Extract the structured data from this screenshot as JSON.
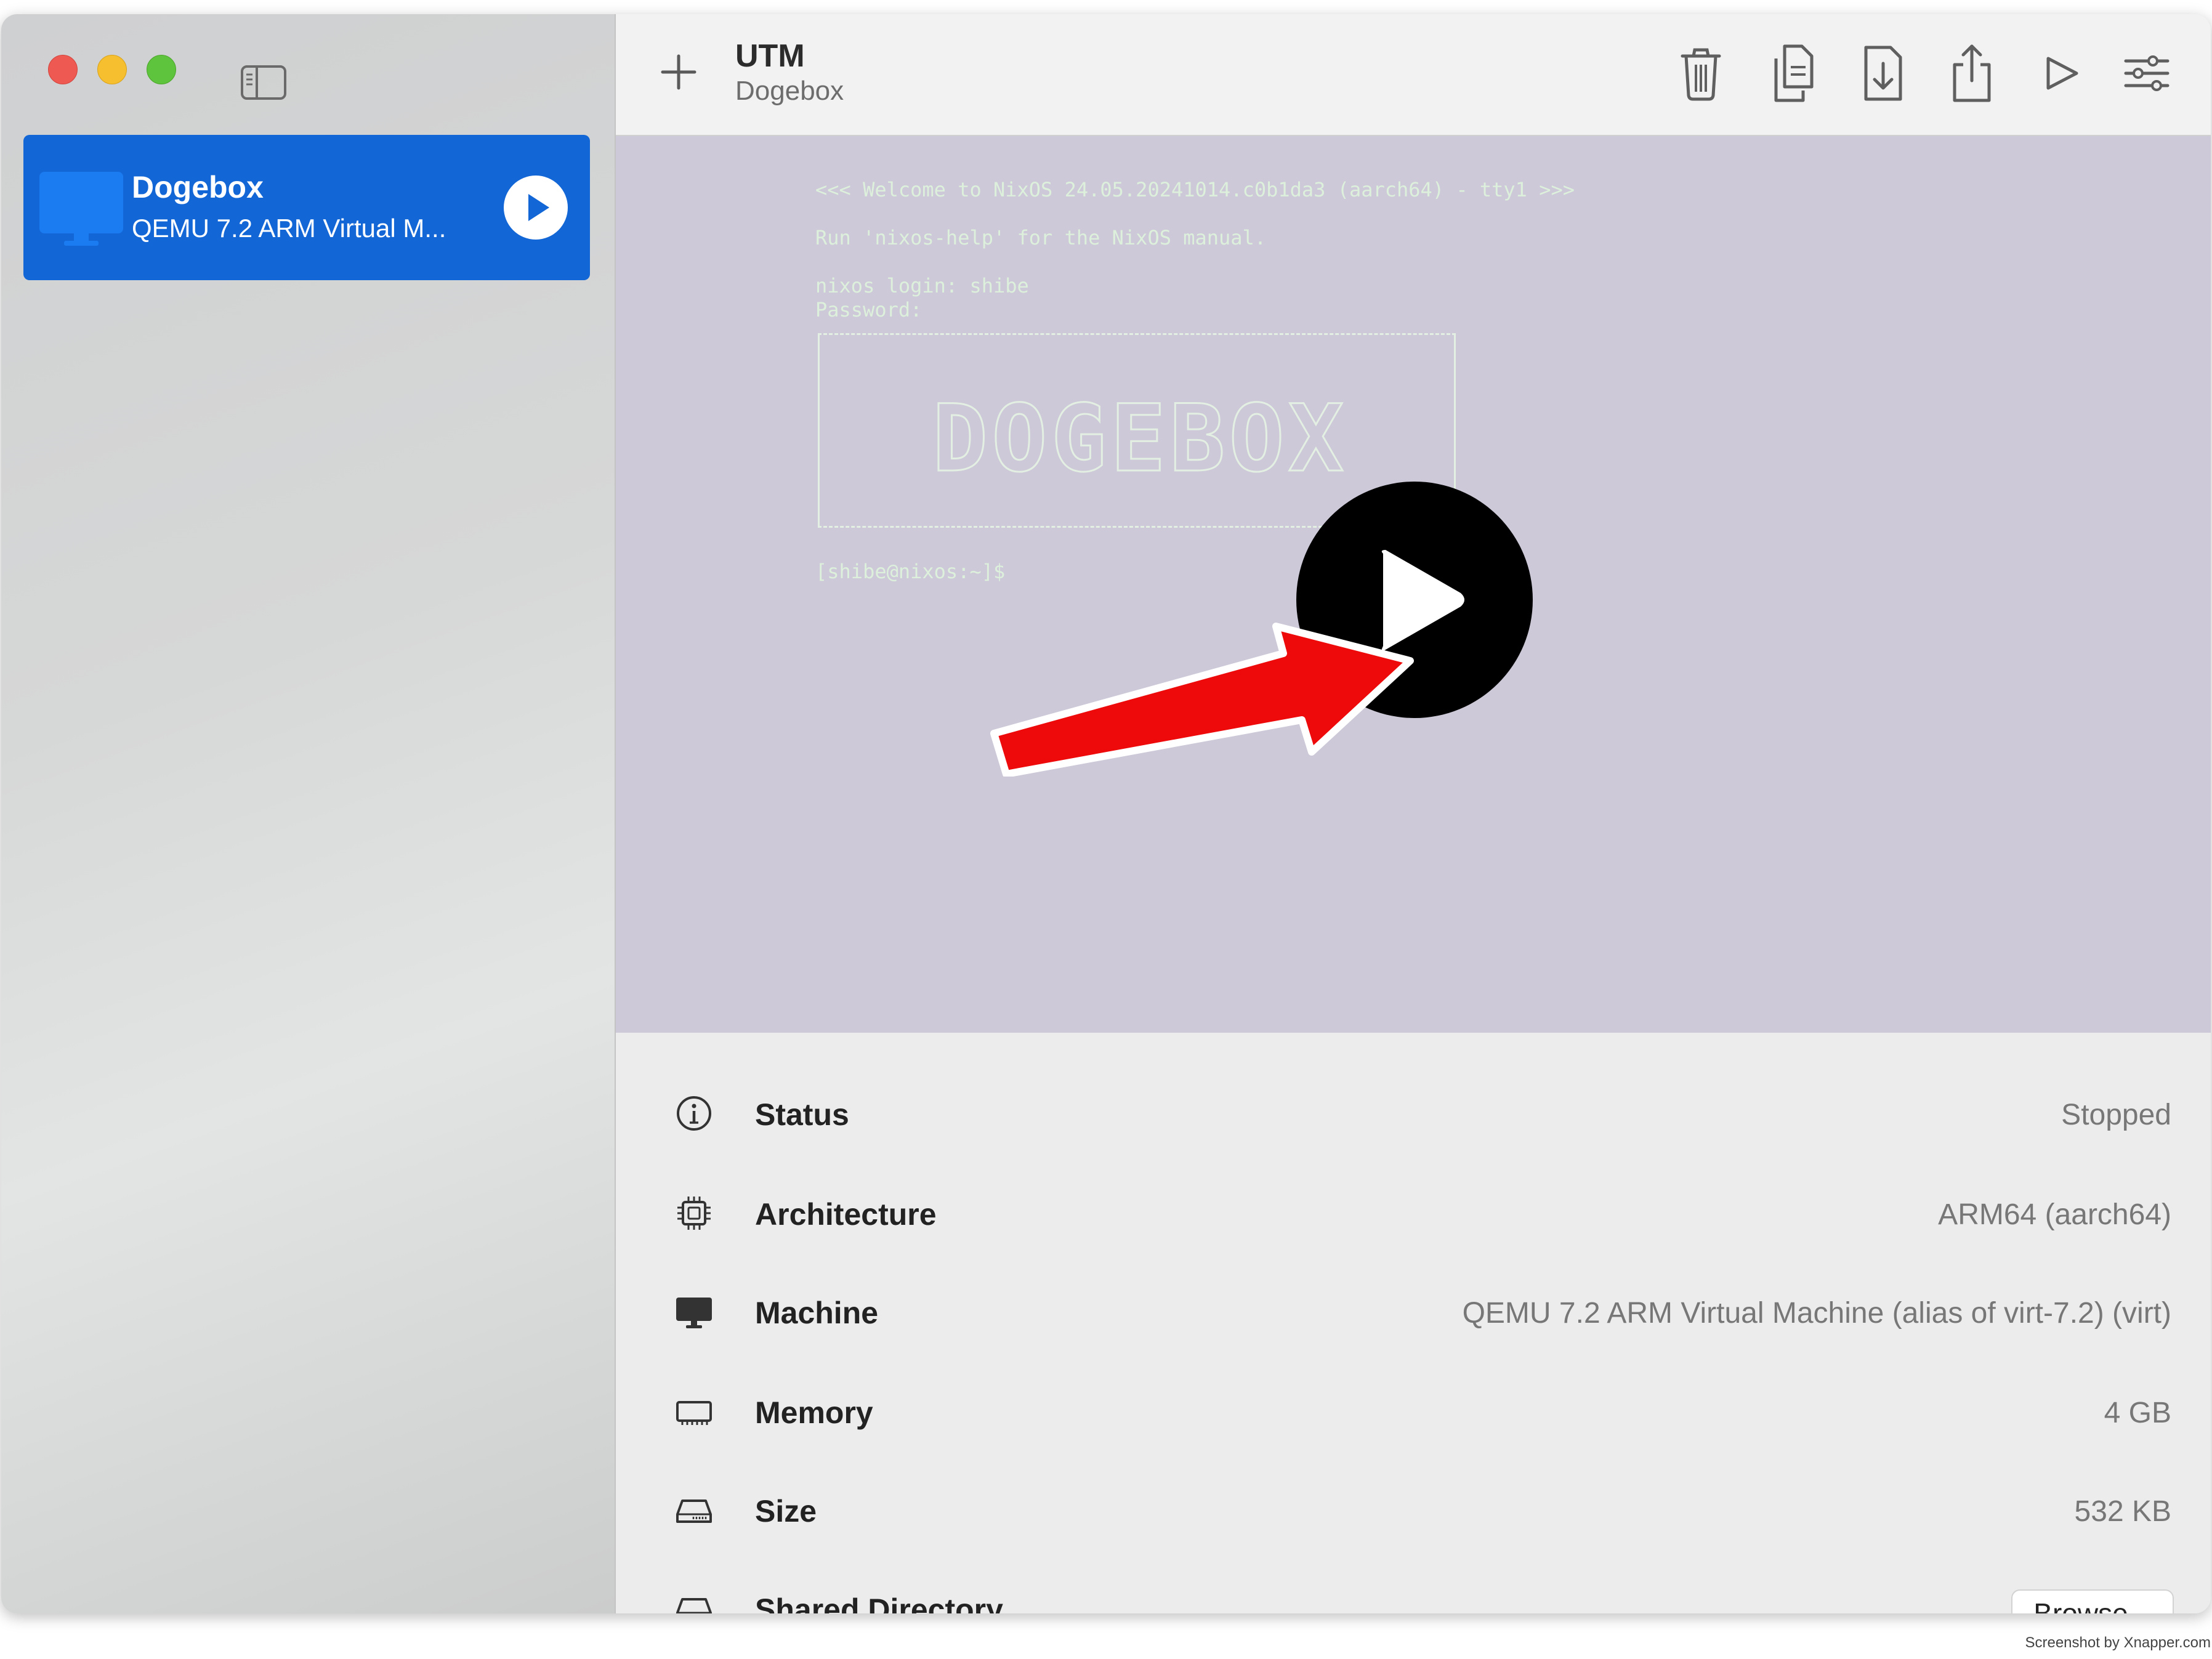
{
  "window": {
    "traffic_lights": [
      "close",
      "minimize",
      "zoom"
    ]
  },
  "sidebar": {
    "toggle_icon": "sidebar-toggle-icon",
    "vm_list": [
      {
        "name": "Dogebox",
        "description": "QEMU 7.2 ARM Virtual M...",
        "icon": "monitor-icon",
        "action_icon": "play-icon",
        "selected": true
      }
    ]
  },
  "toolbar": {
    "add_icon": "plus-icon",
    "title": "UTM",
    "subtitle": "Dogebox",
    "actions": [
      {
        "name": "delete",
        "icon": "trash-icon"
      },
      {
        "name": "clone",
        "icon": "clone-icon"
      },
      {
        "name": "download",
        "icon": "download-icon"
      },
      {
        "name": "share",
        "icon": "share-icon"
      },
      {
        "name": "run",
        "icon": "play-icon"
      },
      {
        "name": "settings",
        "icon": "sliders-icon"
      }
    ]
  },
  "console": {
    "lines": [
      "<<< Welcome to NixOS 24.05.20241014.c0b1da3 (aarch64) - tty1 >>>",
      "Run 'nixos-help' for the NixOS manual.",
      "nixos login: shibe",
      "Password:",
      "[shibe@nixos:~]$"
    ],
    "banner_text": "DOGEBOX",
    "overlay_icon": "big-play-icon",
    "annotation": "red-arrow"
  },
  "info": {
    "rows": [
      {
        "icon": "info-icon",
        "label": "Status",
        "value": "Stopped"
      },
      {
        "icon": "cpu-icon",
        "label": "Architecture",
        "value": "ARM64 (aarch64)"
      },
      {
        "icon": "display-icon",
        "label": "Machine",
        "value": "QEMU 7.2 ARM Virtual Machine (alias of virt-7.2) (virt)"
      },
      {
        "icon": "memory-icon",
        "label": "Memory",
        "value": "4 GB"
      },
      {
        "icon": "drive-icon",
        "label": "Size",
        "value": "532 KB"
      },
      {
        "icon": "shared-drive-icon",
        "label": "Shared Directory",
        "value": ""
      }
    ],
    "browse_label": "Browse..."
  },
  "watermark": "Screenshot by Xnapper.com",
  "colors": {
    "selection": "#1266d6",
    "console_bg": "#cdc9d8",
    "console_text": "#ddf0dc",
    "arrow": "#ee0a0a"
  }
}
